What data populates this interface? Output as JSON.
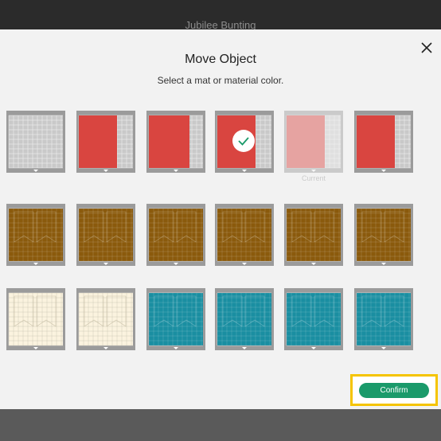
{
  "window": {
    "title": "Jubilee Bunting"
  },
  "dialog": {
    "title": "Move Object",
    "subtitle": "Select a mat or material color.",
    "confirm_label": "Confirm",
    "current_label": "Current"
  },
  "mats": [
    {
      "id": "mat-1",
      "color": "#bfbfbf",
      "kind": "gray",
      "selected": false,
      "current": false
    },
    {
      "id": "mat-2",
      "color": "#d94540",
      "kind": "red-narrow",
      "selected": false,
      "current": false
    },
    {
      "id": "mat-3",
      "color": "#d94540",
      "kind": "red-full",
      "selected": false,
      "current": false
    },
    {
      "id": "mat-4",
      "color": "#d94540",
      "kind": "red-narrow",
      "selected": true,
      "current": false
    },
    {
      "id": "mat-5",
      "color": "#d94540",
      "kind": "faded",
      "selected": false,
      "current": true
    },
    {
      "id": "mat-6",
      "color": "#d94540",
      "kind": "red-narrow",
      "selected": false,
      "current": false
    },
    {
      "id": "mat-7",
      "color": "#8a5a0c",
      "kind": "brown",
      "selected": false,
      "current": false
    },
    {
      "id": "mat-8",
      "color": "#8a5a0c",
      "kind": "brown",
      "selected": false,
      "current": false
    },
    {
      "id": "mat-9",
      "color": "#8a5a0c",
      "kind": "brown",
      "selected": false,
      "current": false
    },
    {
      "id": "mat-10",
      "color": "#8a5a0c",
      "kind": "brown",
      "selected": false,
      "current": false
    },
    {
      "id": "mat-11",
      "color": "#8a5a0c",
      "kind": "brown",
      "selected": false,
      "current": false
    },
    {
      "id": "mat-12",
      "color": "#8a5a0c",
      "kind": "brown",
      "selected": false,
      "current": false
    },
    {
      "id": "mat-13",
      "color": "#fbf3df",
      "kind": "cream",
      "selected": false,
      "current": false
    },
    {
      "id": "mat-14",
      "color": "#fbf3df",
      "kind": "cream",
      "selected": false,
      "current": false
    },
    {
      "id": "mat-15",
      "color": "#1a8ea1",
      "kind": "teal",
      "selected": false,
      "current": false
    },
    {
      "id": "mat-16",
      "color": "#1a8ea1",
      "kind": "teal",
      "selected": false,
      "current": false
    },
    {
      "id": "mat-17",
      "color": "#1a8ea1",
      "kind": "teal",
      "selected": false,
      "current": false
    },
    {
      "id": "mat-18",
      "color": "#1a8ea1",
      "kind": "teal",
      "selected": false,
      "current": false
    }
  ],
  "colors": {
    "accent": "#1a9a6a",
    "highlight": "#f5c400",
    "check": "#1a9a6a"
  },
  "icons": {
    "close": "close-icon",
    "check": "check-icon"
  }
}
